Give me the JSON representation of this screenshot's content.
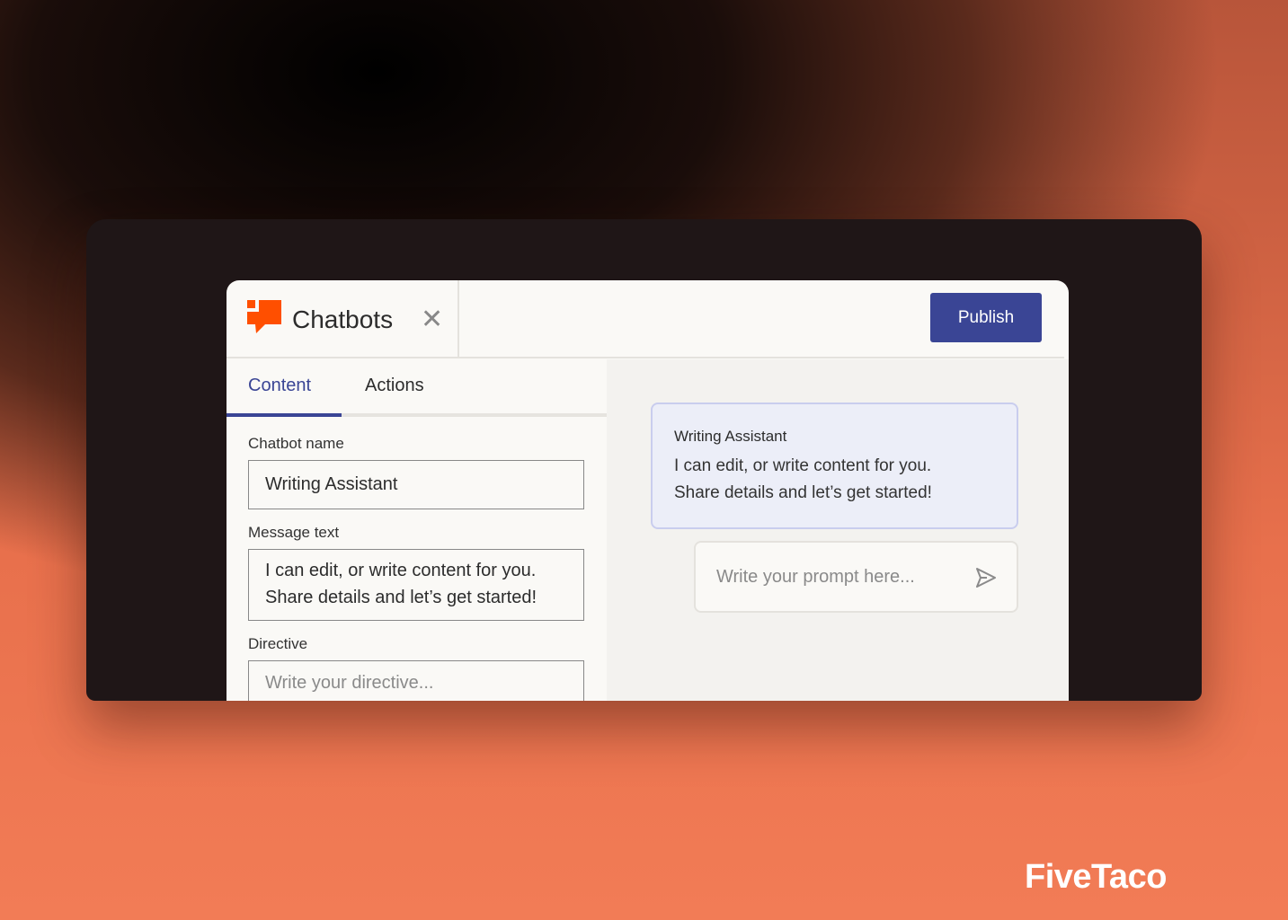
{
  "header": {
    "title": "Chatbots",
    "publish_label": "Publish"
  },
  "tabs": [
    {
      "label": "Content",
      "active": true
    },
    {
      "label": "Actions",
      "active": false
    }
  ],
  "form": {
    "name_label": "Chatbot name",
    "name_value": "Writing Assistant",
    "message_label": "Message text",
    "message_line1": "I can edit, or write content for you.",
    "message_line2": "Share details and let’s get started!",
    "directive_label": "Directive",
    "directive_placeholder": "Write your directive..."
  },
  "preview": {
    "bot_name": "Writing Assistant",
    "line1": "I can edit, or write content for you.",
    "line2": "Share details and let’s get started!",
    "prompt_placeholder": "Write your prompt here..."
  },
  "brand": "FiveTaco",
  "colors": {
    "accent": "#3a4595",
    "logo": "#ff4f00"
  }
}
